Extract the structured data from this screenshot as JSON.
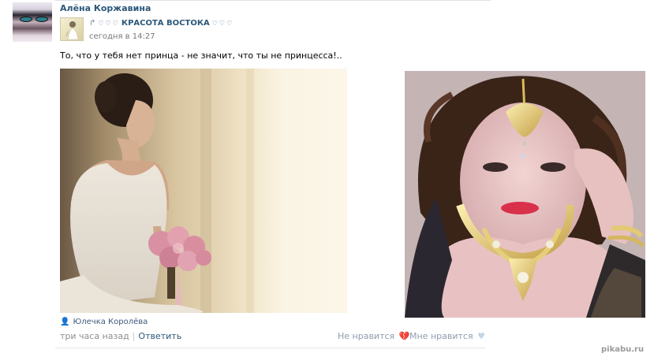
{
  "post": {
    "author": "Алёна Коржавина",
    "group_name": "КРАСОТА ВОСТОКА",
    "time": "сегодня в 14:27",
    "text": "То, что у тебя нет принца - не значит, что ты не принцесса!.."
  },
  "icons": {
    "share": "share-arrow-icon",
    "heart": "heart-icon",
    "person": "person-icon"
  },
  "comment": {
    "author": "Юлечка Королёва",
    "time": "три часа назад",
    "reply": "Ответить",
    "dislike": "Не нравится",
    "like": "Мне нравится"
  },
  "watermark": "pikabu.ru",
  "colors": {
    "link": "#2b587a",
    "muted": "#8e8e8e",
    "heart": "#c3d3e6"
  }
}
